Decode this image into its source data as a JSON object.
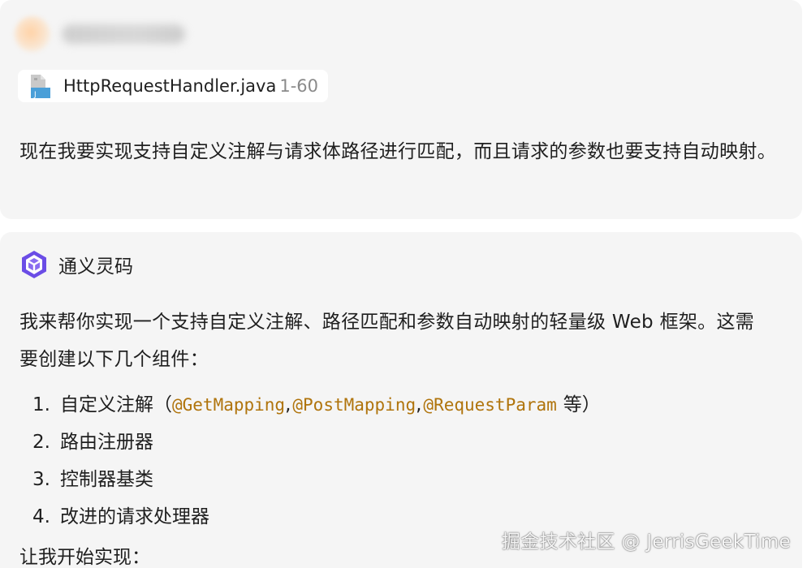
{
  "user_message": {
    "attachment": {
      "file_name": "HttpRequestHandler.java",
      "line_range": "1-60",
      "icon": "java-file-icon"
    },
    "text": "现在我要实现支持自定义注解与请求体路径进行匹配，而且请求的参数也要支持自动映射。"
  },
  "assistant_message": {
    "name": "通义灵码",
    "icon": "tongyi-lingma-logo-icon",
    "intro": "我来帮你实现一个支持自定义注解、路径匹配和参数自动映射的轻量级 Web 框架。这需要创建以下几个组件：",
    "steps": [
      {
        "num": "1.",
        "prefix": "自定义注解（",
        "code1": "@GetMapping",
        "sep1": ",",
        "code2": "@PostMapping",
        "sep2": ",",
        "code3": "@RequestParam",
        "suffix": "等）"
      },
      {
        "num": "2.",
        "label": "路由注册器"
      },
      {
        "num": "3.",
        "label": "控制器基类"
      },
      {
        "num": "4.",
        "label": "改进的请求处理器"
      }
    ],
    "outro": "让我开始实现："
  },
  "watermark": "掘金技术社区 @ JerrisGeekTime",
  "colors": {
    "card_bg": "#f5f5f5",
    "code_text": "#b0740c",
    "secondary_text": "#8a8a8a",
    "logo_accent": "#6b4de6"
  }
}
